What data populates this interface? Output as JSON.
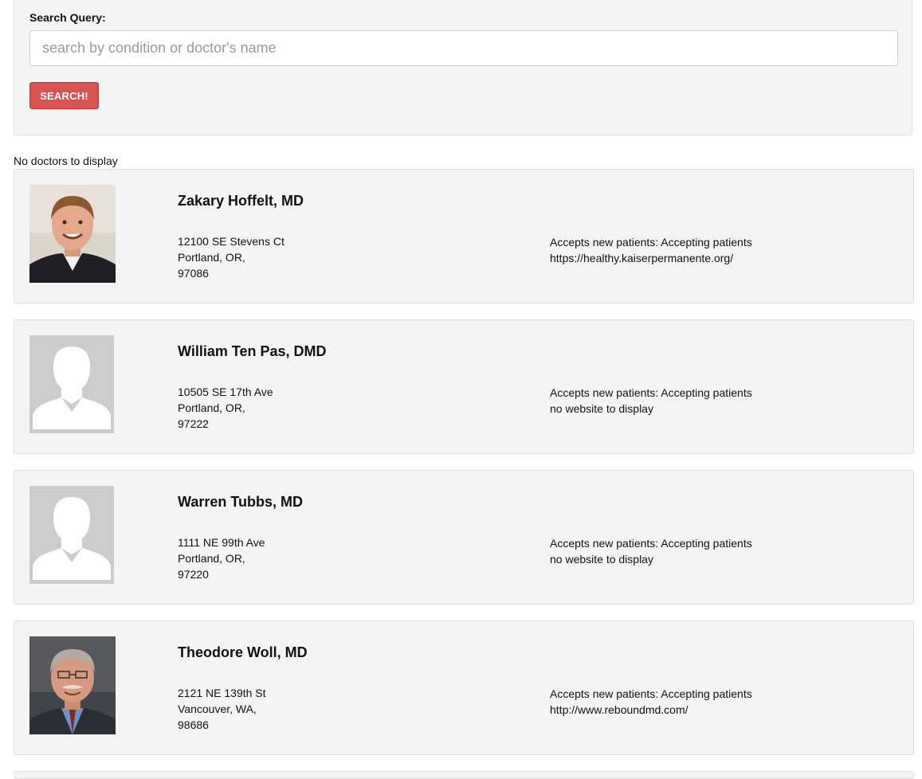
{
  "search": {
    "label": "Search Query:",
    "placeholder": "search by condition or doctor's name",
    "value": "",
    "button_label": "SEARCH!"
  },
  "results": {
    "empty_message": "No doctors to display"
  },
  "doctors": [
    {
      "name": "Zakary Hoffelt, MD",
      "street": "12100 SE Stevens Ct",
      "city_state": "Portland, OR,",
      "zip": "97086",
      "accepting": "Accepts new patients: Accepting patients",
      "website": "https://healthy.kaiserpermanente.org/",
      "photo": "portrait-photo"
    },
    {
      "name": "William Ten Pas, DMD",
      "street": "10505 SE 17th Ave",
      "city_state": "Portland, OR,",
      "zip": "97222",
      "accepting": "Accepts new patients: Accepting patients",
      "website": "no website to display",
      "photo": "default-avatar"
    },
    {
      "name": "Warren Tubbs, MD",
      "street": "1111 NE 99th Ave",
      "city_state": "Portland, OR,",
      "zip": "97220",
      "accepting": "Accepts new patients: Accepting patients",
      "website": "no website to display",
      "photo": "default-avatar"
    },
    {
      "name": "Theodore Woll, MD",
      "street": "2121 NE 139th St",
      "city_state": "Vancouver, WA,",
      "zip": "98686",
      "accepting": "Accepts new patients: Accepting patients",
      "website": "http://www.reboundmd.com/",
      "photo": "portrait-photo"
    }
  ],
  "colors": {
    "page_background": "#ffffff",
    "card_background": "#f4f4f4",
    "card_border": "#dedede",
    "button_background": "#d9534f",
    "avatar_background": "#cccccc"
  }
}
